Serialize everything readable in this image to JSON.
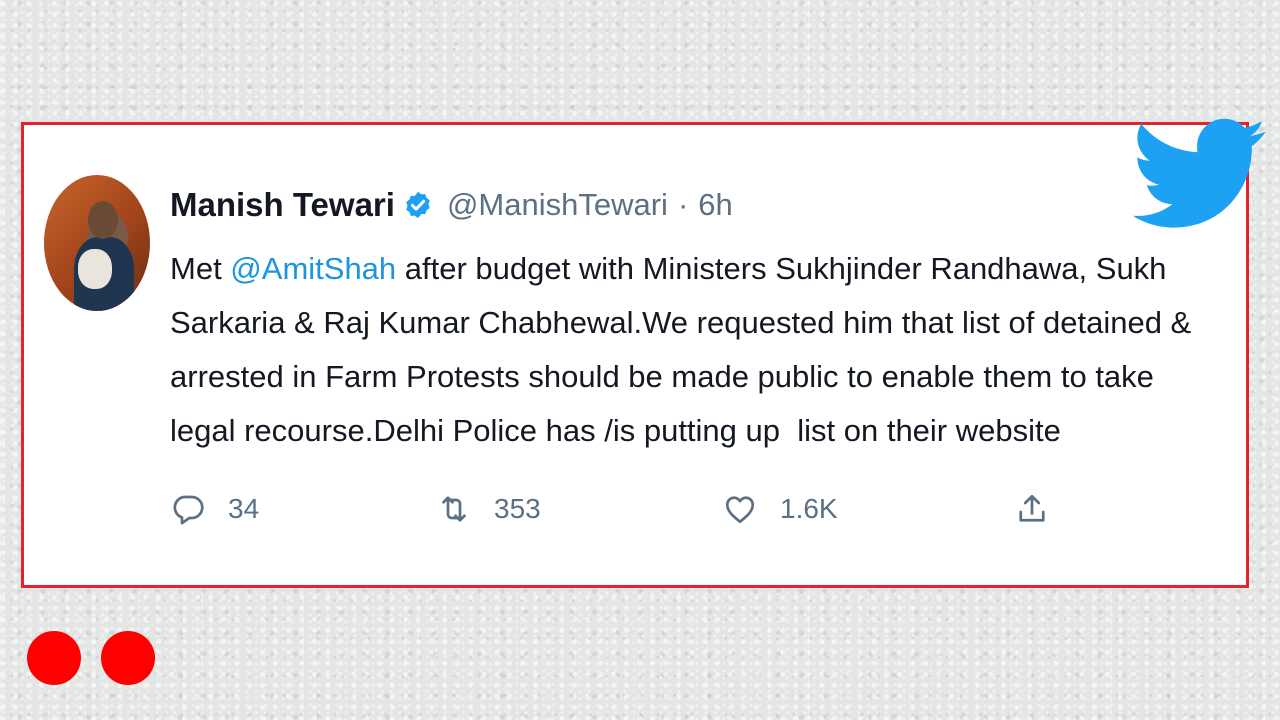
{
  "tweet": {
    "author_name": "Manish Tewari",
    "handle": "@ManishTewari",
    "separator": "·",
    "time": "6h",
    "mention": "@AmitShah",
    "text_before": "Met ",
    "text_after": " after budget with Ministers Sukhjinder Randhawa, Sukh\nSarkaria & Raj Kumar Chabhewal.We requested him that list of detained &\narrested in Farm Protests should be made public to enable them to take\nlegal recourse.Delhi Police has /is putting up  list on their website",
    "verified": true
  },
  "actions": {
    "replies": "34",
    "retweets": "353",
    "likes": "1.6K"
  },
  "colors": {
    "border": "#e8222b",
    "brand_blue": "#1da1f2",
    "mention": "#1b95e0",
    "muted": "#5b7083",
    "dots": "#ff0000"
  },
  "icons": [
    "twitter-bird-icon",
    "verified-badge-icon",
    "reply-icon",
    "retweet-icon",
    "like-icon",
    "share-icon"
  ]
}
